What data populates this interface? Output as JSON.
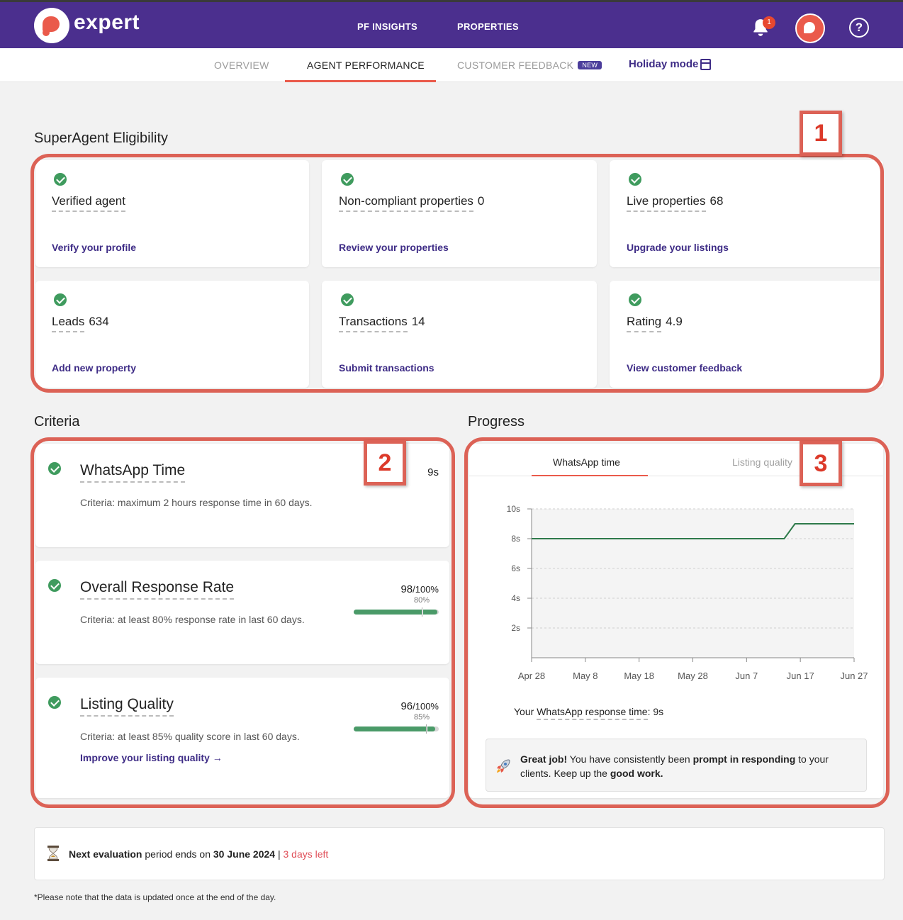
{
  "header": {
    "brand": "expert",
    "nav": [
      "PF INSIGHTS",
      "PROPERTIES"
    ],
    "notification_count": "1",
    "help_symbol": "?"
  },
  "tabs": {
    "overview": "OVERVIEW",
    "agent_performance": "AGENT PERFORMANCE",
    "customer_feedback": "CUSTOMER FEEDBACK",
    "new_badge": "NEW",
    "holiday": "Holiday mode"
  },
  "eligibility": {
    "title": "SuperAgent Eligibility",
    "cards": [
      {
        "label": "Verified agent",
        "value": "",
        "link": "Verify your profile"
      },
      {
        "label": "Non-compliant properties",
        "value": "0",
        "link": "Review your properties"
      },
      {
        "label": "Live properties",
        "value": "68",
        "link": "Upgrade your listings"
      },
      {
        "label": "Leads",
        "value": "634",
        "link": "Add new property"
      },
      {
        "label": "Transactions",
        "value": "14",
        "link": "Submit transactions"
      },
      {
        "label": "Rating",
        "value": "4.9",
        "link": "View customer feedback"
      }
    ]
  },
  "criteria": {
    "title": "Criteria",
    "items": [
      {
        "title": "WhatsApp Time",
        "text": "Criteria: maximum 2 hours response time in 60 days.",
        "value": "9s"
      },
      {
        "title": "Overall Response Rate",
        "text": "Criteria: at least 80% response rate in last 60 days.",
        "value": "98",
        "max": "/100%",
        "threshold": "80%",
        "progress": 0.98,
        "threshold_frac": 0.8
      },
      {
        "title": "Listing Quality",
        "text": "Criteria: at least 85% quality score in last 60 days.",
        "value": "96",
        "max": "/100%",
        "threshold": "85%",
        "progress": 0.96,
        "threshold_frac": 0.85,
        "link": "Improve your listing quality"
      }
    ],
    "link_arrow": "→"
  },
  "progress": {
    "title": "Progress",
    "tabs": [
      "WhatsApp time",
      "Listing quality"
    ],
    "your_prefix": "Your ",
    "your_label": "WhatsApp response time",
    "your_value": ": 9s",
    "message_bold_1": "Great job!",
    "message_1": " You have consistently been ",
    "message_bold_2": "prompt in responding",
    "message_2": " to your clients. Keep up the ",
    "message_bold_3": "good work."
  },
  "chart_data": {
    "type": "line",
    "x": [
      "Apr 28",
      "May 8",
      "May 18",
      "May 28",
      "Jun 7",
      "Jun 14",
      "Jun 16",
      "Jun 27"
    ],
    "y": [
      8,
      8,
      8,
      8,
      8,
      8,
      9,
      9
    ],
    "x_ticks": [
      "Apr 28",
      "May 8",
      "May 18",
      "May 28",
      "Jun 7",
      "Jun 17",
      "Jun 27"
    ],
    "y_ticks": [
      "10s",
      "8s",
      "6s",
      "4s",
      "2s"
    ],
    "ylim": [
      0,
      10
    ],
    "grid": true,
    "line_color": "#2e7a4a"
  },
  "annotations": [
    "1",
    "2",
    "3"
  ],
  "footer": {
    "eval_bold": "Next evaluation",
    "eval_mid": " period ends on ",
    "eval_date": "30 June 2024",
    "eval_sep": " | ",
    "eval_left": "3 days left",
    "note": "*Please note that the data is updated once at the end of the day."
  },
  "colors": {
    "header_bg": "#4b2f8e",
    "accent": "#ea5a4b",
    "link": "#3e2c86",
    "success": "#3f9b5e",
    "annotation": "#dc6256"
  }
}
